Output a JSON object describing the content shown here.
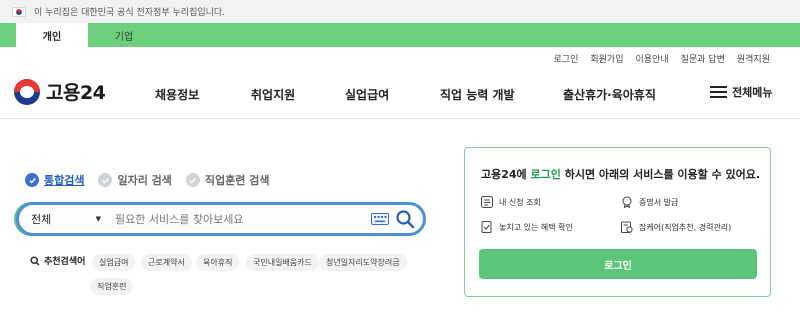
{
  "gov_banner": {
    "text": "이 누리집은 대한민국 공식 전자정부 누리집입니다."
  },
  "tabs": [
    {
      "label": "개인",
      "active": true
    },
    {
      "label": "기업",
      "active": false
    }
  ],
  "util_links": [
    "로그인",
    "회원가입",
    "이용안내",
    "질문과 답변",
    "원격지원"
  ],
  "logo": {
    "text": "고용24"
  },
  "menu": [
    "채용정보",
    "취업지원",
    "실업급여",
    "직업 능력 개발",
    "출산휴가·육아휴직"
  ],
  "all_menu_label": "전체메뉴",
  "search_tabs": [
    {
      "label": "통합검색",
      "active": true
    },
    {
      "label": "일자리 검색",
      "active": false
    },
    {
      "label": "직업훈련 검색",
      "active": false
    }
  ],
  "search": {
    "scope": "전체",
    "placeholder": "필요한 서비스를 찾아보세요"
  },
  "recommend": {
    "label": "추천검색어",
    "chips": [
      "실업급여",
      "근로계약서",
      "육아휴직",
      "국민내일배움카드",
      "청년일자리도약장려금",
      "직업훈련"
    ]
  },
  "panel": {
    "title_pre": "고용24에 ",
    "title_hl": "로그인",
    "title_post": " 하시면 아래의 서비스를 이용할 수 있어요.",
    "services": [
      "내 신청 조회",
      "증명서 발급",
      "놓치고 있는 혜택 확인",
      "잡케어(직업추천, 경력관리)"
    ],
    "login_button": "로그인"
  },
  "colors": {
    "brand_green": "#5bc57a",
    "search_border": "#4c8ed9",
    "link_blue": "#1f5fbf"
  }
}
